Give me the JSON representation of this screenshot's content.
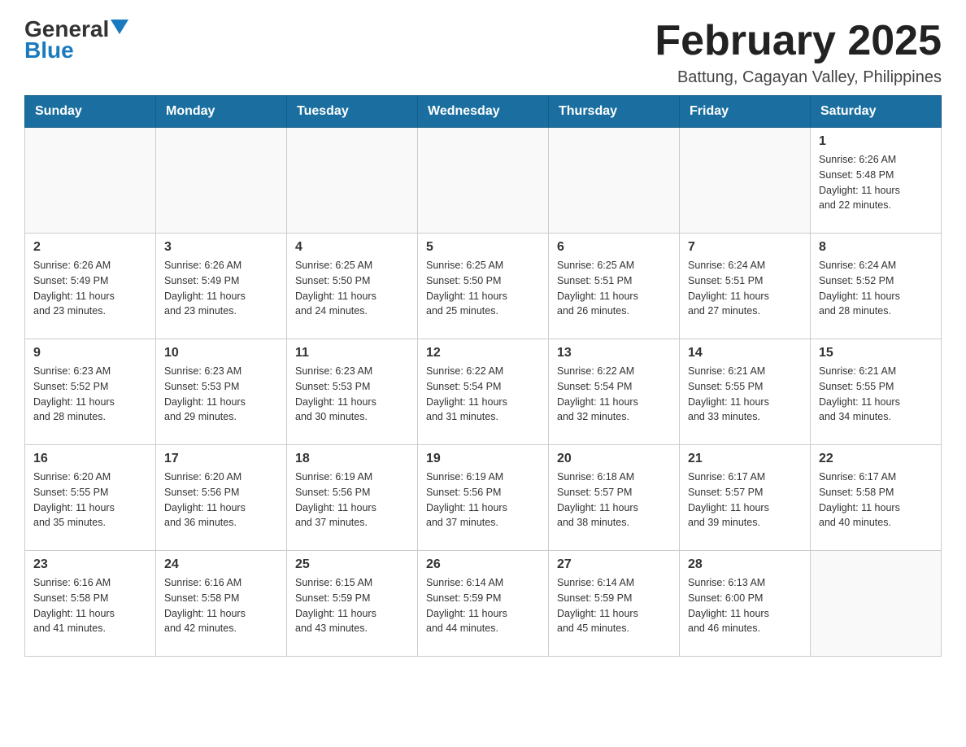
{
  "logo": {
    "general": "General",
    "blue": "Blue",
    "arrow_color": "#1a7abf"
  },
  "header": {
    "title": "February 2025",
    "subtitle": "Battung, Cagayan Valley, Philippines"
  },
  "weekdays": [
    "Sunday",
    "Monday",
    "Tuesday",
    "Wednesday",
    "Thursday",
    "Friday",
    "Saturday"
  ],
  "weeks": [
    [
      {
        "day": "",
        "info": ""
      },
      {
        "day": "",
        "info": ""
      },
      {
        "day": "",
        "info": ""
      },
      {
        "day": "",
        "info": ""
      },
      {
        "day": "",
        "info": ""
      },
      {
        "day": "",
        "info": ""
      },
      {
        "day": "1",
        "info": "Sunrise: 6:26 AM\nSunset: 5:48 PM\nDaylight: 11 hours\nand 22 minutes."
      }
    ],
    [
      {
        "day": "2",
        "info": "Sunrise: 6:26 AM\nSunset: 5:49 PM\nDaylight: 11 hours\nand 23 minutes."
      },
      {
        "day": "3",
        "info": "Sunrise: 6:26 AM\nSunset: 5:49 PM\nDaylight: 11 hours\nand 23 minutes."
      },
      {
        "day": "4",
        "info": "Sunrise: 6:25 AM\nSunset: 5:50 PM\nDaylight: 11 hours\nand 24 minutes."
      },
      {
        "day": "5",
        "info": "Sunrise: 6:25 AM\nSunset: 5:50 PM\nDaylight: 11 hours\nand 25 minutes."
      },
      {
        "day": "6",
        "info": "Sunrise: 6:25 AM\nSunset: 5:51 PM\nDaylight: 11 hours\nand 26 minutes."
      },
      {
        "day": "7",
        "info": "Sunrise: 6:24 AM\nSunset: 5:51 PM\nDaylight: 11 hours\nand 27 minutes."
      },
      {
        "day": "8",
        "info": "Sunrise: 6:24 AM\nSunset: 5:52 PM\nDaylight: 11 hours\nand 28 minutes."
      }
    ],
    [
      {
        "day": "9",
        "info": "Sunrise: 6:23 AM\nSunset: 5:52 PM\nDaylight: 11 hours\nand 28 minutes."
      },
      {
        "day": "10",
        "info": "Sunrise: 6:23 AM\nSunset: 5:53 PM\nDaylight: 11 hours\nand 29 minutes."
      },
      {
        "day": "11",
        "info": "Sunrise: 6:23 AM\nSunset: 5:53 PM\nDaylight: 11 hours\nand 30 minutes."
      },
      {
        "day": "12",
        "info": "Sunrise: 6:22 AM\nSunset: 5:54 PM\nDaylight: 11 hours\nand 31 minutes."
      },
      {
        "day": "13",
        "info": "Sunrise: 6:22 AM\nSunset: 5:54 PM\nDaylight: 11 hours\nand 32 minutes."
      },
      {
        "day": "14",
        "info": "Sunrise: 6:21 AM\nSunset: 5:55 PM\nDaylight: 11 hours\nand 33 minutes."
      },
      {
        "day": "15",
        "info": "Sunrise: 6:21 AM\nSunset: 5:55 PM\nDaylight: 11 hours\nand 34 minutes."
      }
    ],
    [
      {
        "day": "16",
        "info": "Sunrise: 6:20 AM\nSunset: 5:55 PM\nDaylight: 11 hours\nand 35 minutes."
      },
      {
        "day": "17",
        "info": "Sunrise: 6:20 AM\nSunset: 5:56 PM\nDaylight: 11 hours\nand 36 minutes."
      },
      {
        "day": "18",
        "info": "Sunrise: 6:19 AM\nSunset: 5:56 PM\nDaylight: 11 hours\nand 37 minutes."
      },
      {
        "day": "19",
        "info": "Sunrise: 6:19 AM\nSunset: 5:56 PM\nDaylight: 11 hours\nand 37 minutes."
      },
      {
        "day": "20",
        "info": "Sunrise: 6:18 AM\nSunset: 5:57 PM\nDaylight: 11 hours\nand 38 minutes."
      },
      {
        "day": "21",
        "info": "Sunrise: 6:17 AM\nSunset: 5:57 PM\nDaylight: 11 hours\nand 39 minutes."
      },
      {
        "day": "22",
        "info": "Sunrise: 6:17 AM\nSunset: 5:58 PM\nDaylight: 11 hours\nand 40 minutes."
      }
    ],
    [
      {
        "day": "23",
        "info": "Sunrise: 6:16 AM\nSunset: 5:58 PM\nDaylight: 11 hours\nand 41 minutes."
      },
      {
        "day": "24",
        "info": "Sunrise: 6:16 AM\nSunset: 5:58 PM\nDaylight: 11 hours\nand 42 minutes."
      },
      {
        "day": "25",
        "info": "Sunrise: 6:15 AM\nSunset: 5:59 PM\nDaylight: 11 hours\nand 43 minutes."
      },
      {
        "day": "26",
        "info": "Sunrise: 6:14 AM\nSunset: 5:59 PM\nDaylight: 11 hours\nand 44 minutes."
      },
      {
        "day": "27",
        "info": "Sunrise: 6:14 AM\nSunset: 5:59 PM\nDaylight: 11 hours\nand 45 minutes."
      },
      {
        "day": "28",
        "info": "Sunrise: 6:13 AM\nSunset: 6:00 PM\nDaylight: 11 hours\nand 46 minutes."
      },
      {
        "day": "",
        "info": ""
      }
    ]
  ]
}
